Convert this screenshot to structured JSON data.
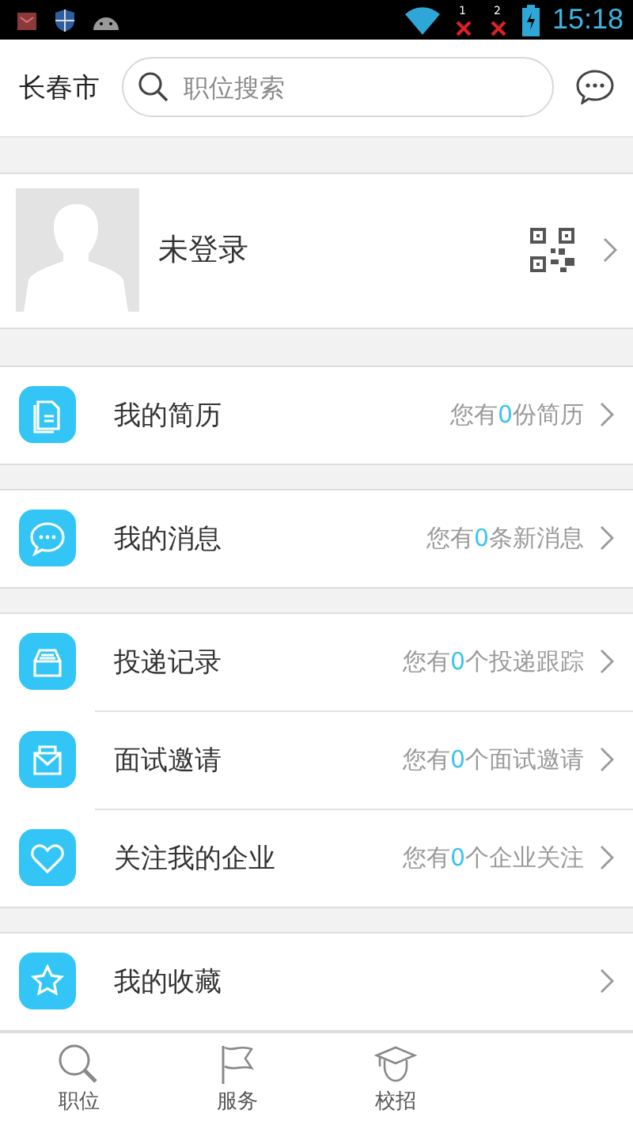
{
  "status_bar": {
    "time": "15:18",
    "sim_badges": [
      "1",
      "2"
    ]
  },
  "header": {
    "city": "长春市",
    "search": {
      "placeholder": "职位搜索"
    }
  },
  "profile": {
    "name": "未登录"
  },
  "menu_groups": [
    [
      {
        "kind": "resume",
        "label": "我的简历",
        "note": {
          "prefix": "您有",
          "count": "0",
          "suffix": "份简历"
        }
      }
    ],
    [
      {
        "kind": "message",
        "label": "我的消息",
        "note": {
          "prefix": "您有",
          "count": "0",
          "suffix": "条新消息"
        }
      }
    ],
    [
      {
        "kind": "delivery",
        "label": "投递记录",
        "note": {
          "prefix": "您有",
          "count": "0",
          "suffix": "个投递跟踪"
        }
      },
      {
        "kind": "interview",
        "label": "面试邀请",
        "note": {
          "prefix": "您有",
          "count": "0",
          "suffix": "个面试邀请"
        }
      },
      {
        "kind": "follow",
        "label": "关注我的企业",
        "note": {
          "prefix": "您有",
          "count": "0",
          "suffix": "个企业关注"
        }
      }
    ],
    [
      {
        "kind": "favorite",
        "label": "我的收藏"
      }
    ]
  ],
  "tab_bar": [
    {
      "kind": "search",
      "label": "职位"
    },
    {
      "kind": "flag",
      "label": "服务"
    },
    {
      "kind": "campus",
      "label": "校招"
    }
  ]
}
